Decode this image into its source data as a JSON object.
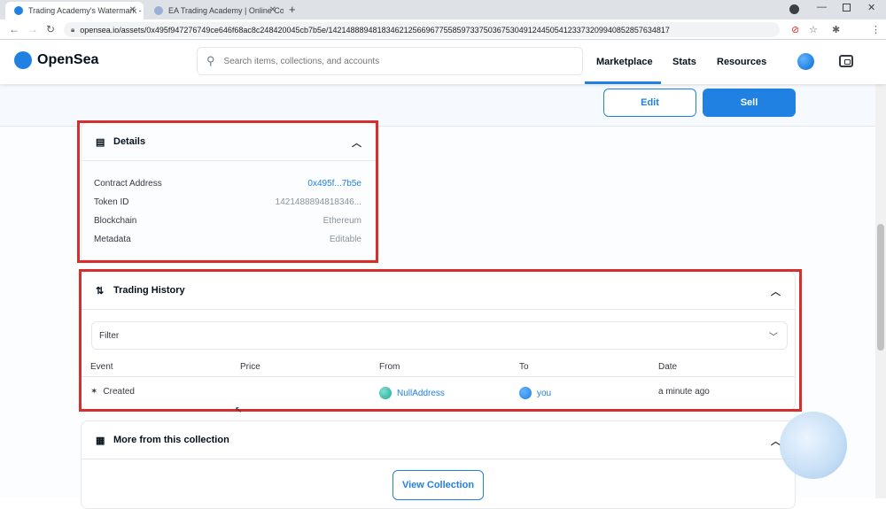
{
  "browser": {
    "tabs": [
      {
        "title": "Trading Academy's Watermark -",
        "active": true
      },
      {
        "title": "EA Trading Academy | Online Co",
        "active": false
      }
    ],
    "new_tab": "+",
    "url": "opensea.io/assets/0x495f947276749ce646f68ac8c248420045cb7b5e/14214888948183462125669677558597337503675304912445054123373209940852857634817"
  },
  "header": {
    "brand": "OpenSea",
    "search_placeholder": "Search items, collections, and accounts",
    "nav": [
      "Marketplace",
      "Stats",
      "Resources"
    ]
  },
  "actions": {
    "edit": "Edit",
    "sell": "Sell"
  },
  "details": {
    "title": "Details",
    "rows": [
      {
        "key": "Contract Address",
        "value": "0x495f...7b5e"
      },
      {
        "key": "Token ID",
        "value": "1421488894818346..."
      },
      {
        "key": "Blockchain",
        "value": "Ethereum"
      },
      {
        "key": "Metadata",
        "value": "Editable"
      }
    ]
  },
  "trading_history": {
    "title": "Trading History",
    "filter": "Filter",
    "columns": [
      "Event",
      "Price",
      "From",
      "To",
      "Date"
    ],
    "rows": [
      {
        "event": "Created",
        "price": "",
        "from": "NullAddress",
        "to": "you",
        "date": "a minute ago"
      }
    ]
  },
  "more": {
    "title": "More from this collection",
    "button": "View Collection"
  },
  "colors": {
    "accent": "#2081e2",
    "highlight": "#d62d2d"
  }
}
